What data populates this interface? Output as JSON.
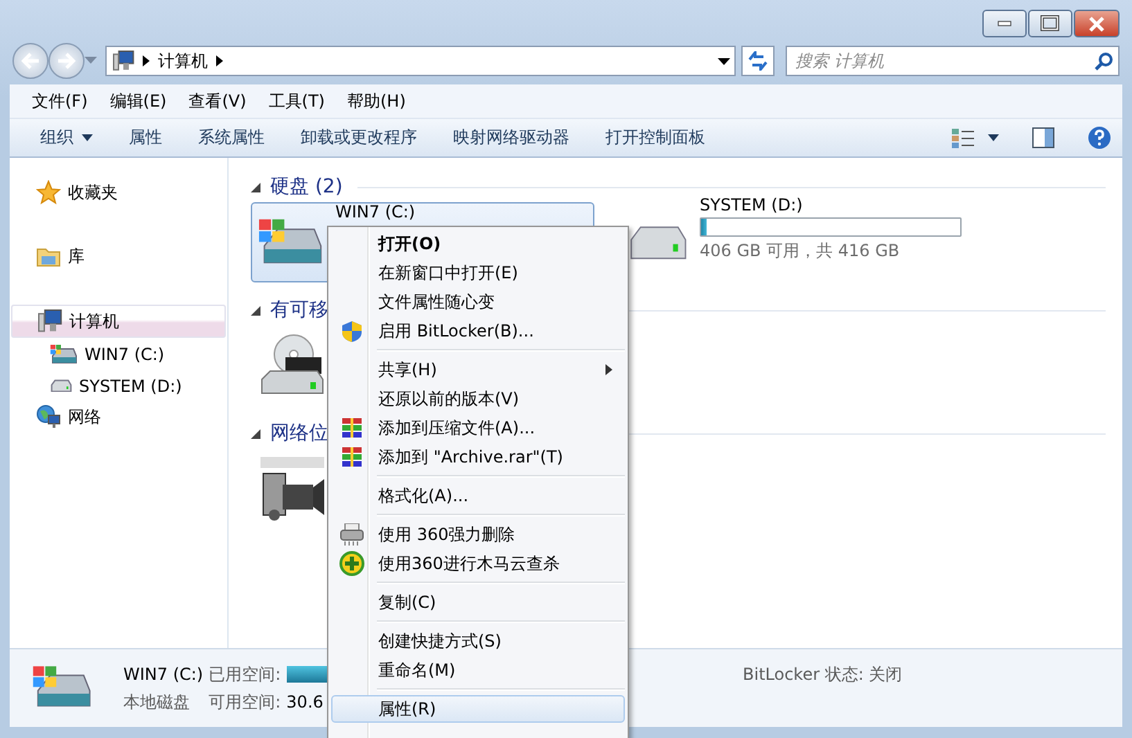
{
  "address_bar": {
    "location": "计算机"
  },
  "search": {
    "placeholder": "搜索 计算机"
  },
  "menu_bar": [
    "文件(F)",
    "编辑(E)",
    "查看(V)",
    "工具(T)",
    "帮助(H)"
  ],
  "toolbar": [
    {
      "label": "组织",
      "dropdown": true
    },
    {
      "label": "属性",
      "dropdown": false
    },
    {
      "label": "系统属性",
      "dropdown": false
    },
    {
      "label": "卸载或更改程序",
      "dropdown": false
    },
    {
      "label": "映射网络驱动器",
      "dropdown": false
    },
    {
      "label": "打开控制面板",
      "dropdown": false
    }
  ],
  "sidebar": {
    "items": [
      {
        "label": "收藏夹",
        "kind": "favorites",
        "selected": false
      },
      {
        "label": "库",
        "kind": "libraries",
        "selected": false
      },
      {
        "label": "计算机",
        "kind": "computer",
        "selected": true,
        "children": [
          {
            "label": "WIN7 (C:)",
            "kind": "system-drive",
            "selected": false
          },
          {
            "label": "SYSTEM (D:)",
            "kind": "drive",
            "selected": false
          }
        ]
      },
      {
        "label": "网络",
        "kind": "network",
        "selected": false
      }
    ]
  },
  "content": {
    "groups": [
      {
        "title": "硬盘 (2)",
        "items": [
          {
            "name": "WIN7 (C:)",
            "kind": "system-drive",
            "selected": true
          },
          {
            "name": "SYSTEM (D:)",
            "kind": "drive",
            "selected": false,
            "level": 0.024,
            "free": "406 GB 可用，共 416 GB"
          }
        ]
      },
      {
        "title": "有可移",
        "items": [
          {
            "kind": "dvd",
            "selected": false
          }
        ]
      },
      {
        "title": "网络位",
        "items": [
          {
            "kind": "camera",
            "selected": false
          }
        ]
      }
    ]
  },
  "details": {
    "name": "WIN7 (C:)",
    "type": "本地磁盘",
    "used_label": "已用空间:",
    "free_label": "可用空间:",
    "free_value": "30.6",
    "bitlocker": "BitLocker 状态: 关闭"
  },
  "context_menu": [
    {
      "kind": "item",
      "label": "打开(O)",
      "bold": true,
      "highlighted": false
    },
    {
      "kind": "item",
      "label": "在新窗口中打开(E)",
      "bold": false,
      "highlighted": false
    },
    {
      "kind": "item",
      "label": "文件属性随心变",
      "bold": false,
      "highlighted": false
    },
    {
      "kind": "item",
      "label": "启用 BitLocker(B)...",
      "bold": false,
      "highlighted": false
    },
    {
      "kind": "separator"
    },
    {
      "kind": "item",
      "label": "共享(H)",
      "submenu": true,
      "bold": false,
      "highlighted": false
    },
    {
      "kind": "item",
      "label": "还原以前的版本(V)",
      "bold": false,
      "highlighted": false
    },
    {
      "kind": "item",
      "label": "添加到压缩文件(A)...",
      "bold": false,
      "highlighted": false
    },
    {
      "kind": "item",
      "label": "添加到 \"Archive.rar\"(T)",
      "bold": false,
      "highlighted": false
    },
    {
      "kind": "separator"
    },
    {
      "kind": "item",
      "label": "格式化(A)...",
      "bold": false,
      "highlighted": false
    },
    {
      "kind": "separator"
    },
    {
      "kind": "item",
      "label": "使用 360强力删除",
      "bold": false,
      "highlighted": false
    },
    {
      "kind": "item",
      "label": "使用360进行木马云查杀",
      "bold": false,
      "highlighted": false
    },
    {
      "kind": "separator"
    },
    {
      "kind": "item",
      "label": "复制(C)",
      "bold": false,
      "highlighted": false
    },
    {
      "kind": "separator"
    },
    {
      "kind": "item",
      "label": "创建快捷方式(S)",
      "bold": false,
      "highlighted": false
    },
    {
      "kind": "item",
      "label": "重命名(M)",
      "bold": false,
      "highlighted": false
    },
    {
      "kind": "separator"
    },
    {
      "kind": "item",
      "label": "属性(R)",
      "bold": false,
      "highlighted": true
    }
  ]
}
